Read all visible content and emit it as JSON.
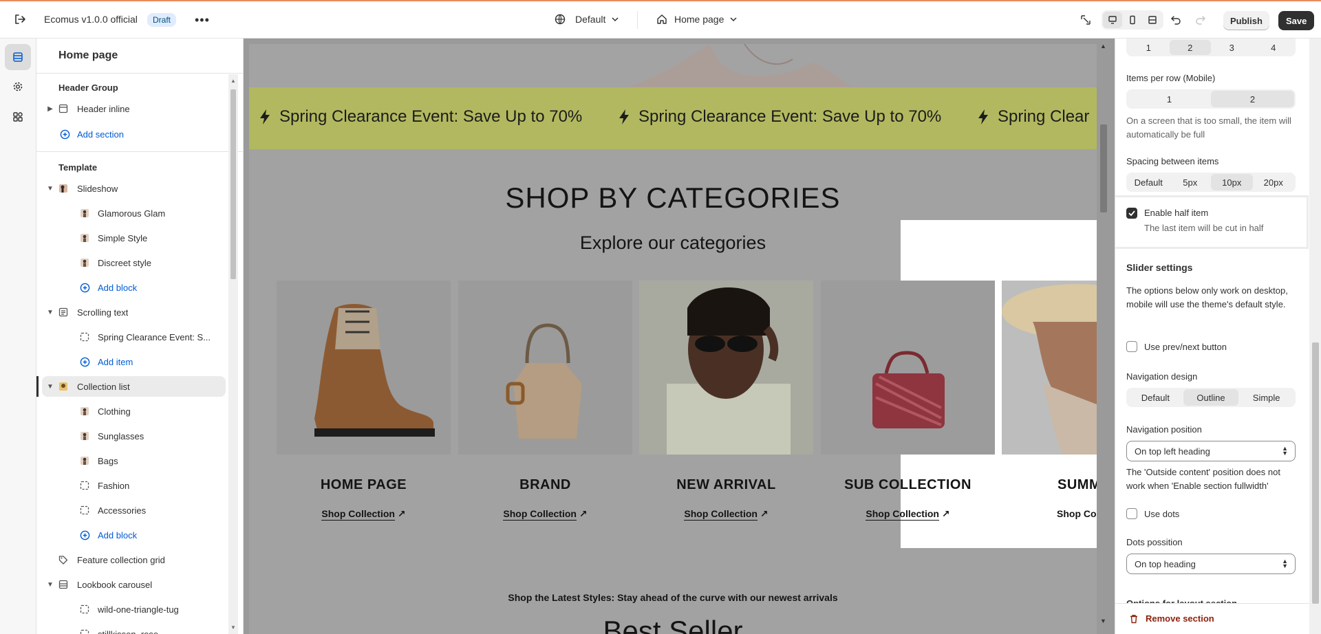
{
  "topbar": {
    "store_name": "Ecomus v1.0.0 official",
    "status_badge": "Draft",
    "theme_select": "Default",
    "page_select": "Home page",
    "publish_label": "Publish",
    "save_label": "Save"
  },
  "sidebar": {
    "title": "Home page",
    "header_group": "Header Group",
    "header_inline": "Header inline",
    "add_section": "Add section",
    "template": "Template",
    "items": [
      {
        "label": "Slideshow",
        "level": 1,
        "icon": "image-icon"
      },
      {
        "label": "Glamorous Glam",
        "level": 2,
        "icon": "thumb-icon"
      },
      {
        "label": "Simple Style",
        "level": 2,
        "icon": "thumb-icon"
      },
      {
        "label": "Discreet style",
        "level": 2,
        "icon": "thumb-icon"
      },
      {
        "label": "Add block",
        "level": 2,
        "icon": "plus-circle-icon"
      },
      {
        "label": "Scrolling text",
        "level": 1,
        "icon": "text-icon"
      },
      {
        "label": "Spring Clearance Event: S...",
        "level": 2,
        "icon": "block-icon"
      },
      {
        "label": "Add item",
        "level": 2,
        "icon": "plus-circle-icon"
      },
      {
        "label": "Collection list",
        "level": 1,
        "icon": "collection-icon"
      },
      {
        "label": "Clothing",
        "level": 2,
        "icon": "thumb-icon"
      },
      {
        "label": "Sunglasses",
        "level": 2,
        "icon": "thumb-icon"
      },
      {
        "label": "Bags",
        "level": 2,
        "icon": "thumb-icon"
      },
      {
        "label": "Fashion",
        "level": 2,
        "icon": "block-icon"
      },
      {
        "label": "Accessories",
        "level": 2,
        "icon": "block-icon"
      },
      {
        "label": "Add block",
        "level": 2,
        "icon": "plus-circle-icon"
      },
      {
        "label": "Feature collection grid",
        "level": 1,
        "icon": "tag-icon"
      },
      {
        "label": "Lookbook carousel",
        "level": 1,
        "icon": "carousel-icon"
      },
      {
        "label": "wild-one-triangle-tug",
        "level": 2,
        "icon": "block-icon"
      },
      {
        "label": "stillkissen_rose",
        "level": 2,
        "icon": "block-icon"
      }
    ]
  },
  "preview": {
    "marquee_text": "Spring Clearance Event: Save Up to 70%",
    "marquee_partial": "Spring Clear",
    "heading": "SHOP BY CATEGORIES",
    "subheading": "Explore our categories",
    "categories": [
      {
        "title": "HOME PAGE",
        "link": "Shop Collection"
      },
      {
        "title": "BRAND",
        "link": "Shop Collection"
      },
      {
        "title": "NEW ARRIVAL",
        "link": "Shop Collection"
      },
      {
        "title": "SUB COLLECTION",
        "link": "Shop Collection"
      },
      {
        "title": "SUMM",
        "link": "Shop Colle"
      }
    ],
    "bottom_text": "Shop the Latest Styles: Stay ahead of the curve with our newest arrivals",
    "bottom_heading": "Best Seller"
  },
  "panel": {
    "items_desktop_options": [
      "1",
      "2",
      "3",
      "4"
    ],
    "items_mobile_label": "Items per row (Mobile)",
    "items_mobile_options": [
      "1",
      "2"
    ],
    "items_mobile_help": "On a screen that is too small, the item will automatically be full",
    "spacing_label": "Spacing between items",
    "spacing_options": [
      "Default",
      "5px",
      "10px",
      "20px"
    ],
    "half_item_label": "Enable half item",
    "half_item_help": "The last item will be cut in half",
    "slider_settings": "Slider settings",
    "slider_help": "The options below only work on desktop, mobile will use the theme's default style.",
    "prev_next_label": "Use prev/next button",
    "nav_design_label": "Navigation design",
    "nav_design_options": [
      "Default",
      "Outline",
      "Simple"
    ],
    "nav_position_label": "Navigation position",
    "nav_position_value": "On top left heading",
    "nav_position_help": "The 'Outside content' position does not work when 'Enable section fullwidth'",
    "dots_label": "Use dots",
    "dots_position_label": "Dots possition",
    "dots_position_value": "On top heading",
    "layout_options_partial": "Options for layout section",
    "remove_section": "Remove section"
  },
  "colors": {
    "marquee_bg": "#b2b85f",
    "accent_link": "#005bd3",
    "remove": "#8e1f0b"
  }
}
